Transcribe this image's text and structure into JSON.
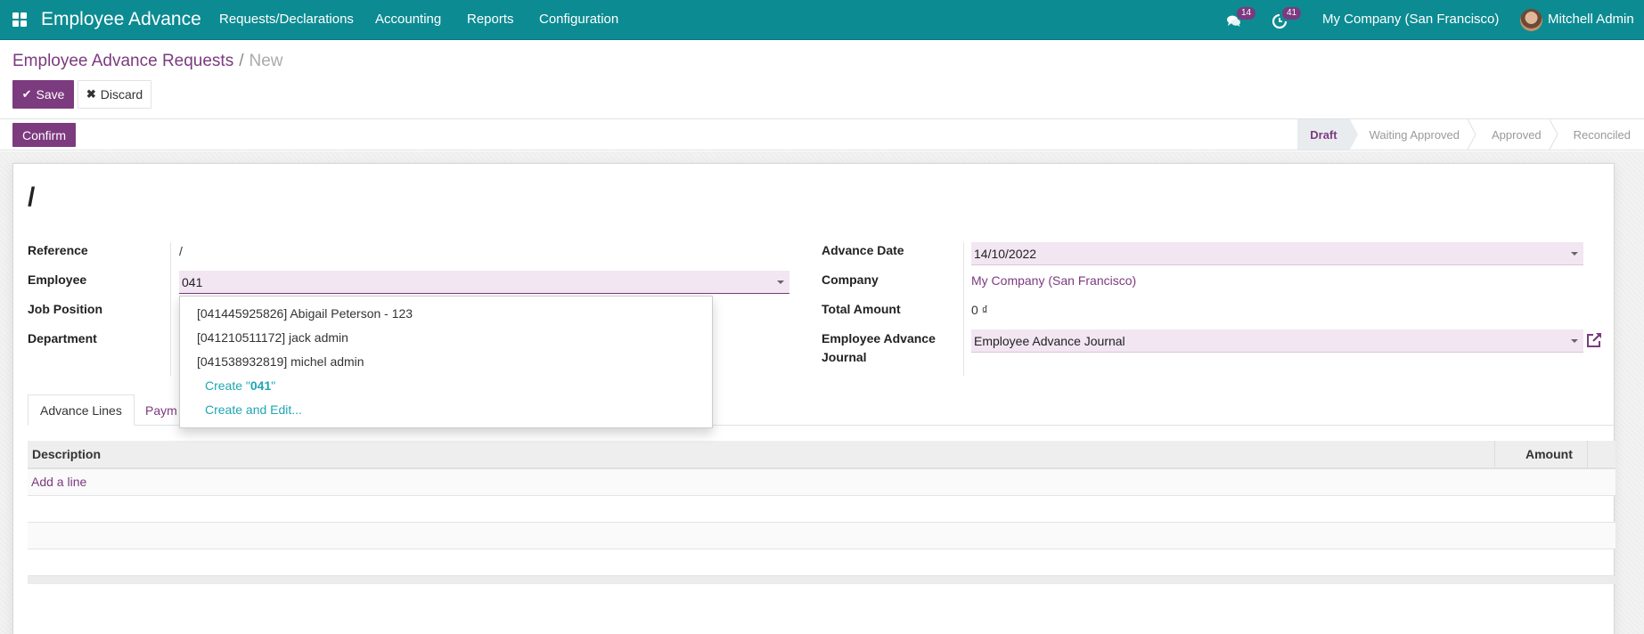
{
  "navbar": {
    "app_name": "Employee Advance",
    "menu": [
      "Requests/Declarations",
      "Accounting",
      "Reports",
      "Configuration"
    ],
    "messages_count": "14",
    "activities_count": "41",
    "company": "My Company (San Francisco)",
    "user": "Mitchell Admin",
    "colors": {
      "bar": "#0c8b92",
      "badge": "#7c3a7f"
    }
  },
  "breadcrumb": {
    "parent": "Employee Advance Requests",
    "separator": "/",
    "current": "New"
  },
  "buttons": {
    "save": "Save",
    "discard": "Discard",
    "confirm": "Confirm"
  },
  "status": {
    "stages": [
      "Draft",
      "Waiting Approved",
      "Approved",
      "Reconciled"
    ],
    "active": "Draft"
  },
  "record": {
    "name": "/",
    "left": {
      "reference_label": "Reference",
      "reference_value": "/",
      "employee_label": "Employee",
      "employee_value": "041",
      "job_label": "Job Position",
      "department_label": "Department"
    },
    "right": {
      "date_label": "Advance Date",
      "date_value": "14/10/2022",
      "company_label": "Company",
      "company_value": "My Company (San Francisco)",
      "total_label": "Total Amount",
      "total_value": "0 ₫",
      "journal_label_1": "Employee Advance",
      "journal_label_2": "Journal",
      "journal_value": "Employee Advance Journal"
    }
  },
  "tabs": [
    "Advance Lines",
    "Paym"
  ],
  "table": {
    "columns": [
      "Description",
      "Amount"
    ],
    "add_line": "Add a line"
  },
  "autocomplete": {
    "items": [
      "[041445925826] Abigail Peterson - 123",
      "[041210511172] jack admin",
      "[041538932819] michel admin"
    ],
    "create_prefix": "Create \"",
    "create_term": "041",
    "create_suffix": "\"",
    "create_edit": "Create and Edit..."
  },
  "colors": {
    "primary": "#7c3a7f",
    "link": "#1fa6b3",
    "field_bg": "#f2e6f2"
  }
}
